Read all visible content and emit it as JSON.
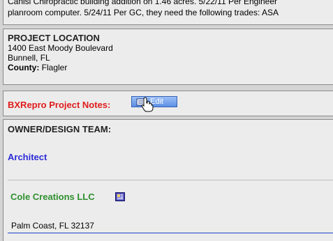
{
  "top": {
    "line1": "Canisi Chiropractic building addition on 1.46 acres. 5/22/11 Per Engineer",
    "line2": "planroom computer. 5/24/11 Per GC, they need the following trades: ASA"
  },
  "location": {
    "title": "PROJECT LOCATION",
    "address": "1400 East Moody Boulevard",
    "city_state": "Bunnell, FL",
    "county_label": "County:",
    "county_value": "Flagler"
  },
  "notes": {
    "label": "BXRepro Project Notes:",
    "edit_label": "Edit"
  },
  "team": {
    "title": "OWNER/DESIGN TEAM:",
    "architect_label": "Architect",
    "company_name": "Cole Creations LLC",
    "company_city": "Palm Coast, FL 32137"
  },
  "colors": {
    "notes_red": "#e01b1b",
    "architect_blue": "#2b2bd8",
    "company_green": "#2f8f2f",
    "edit_button": "#5d8fe4"
  },
  "icons": {
    "edit": "notepad-icon",
    "cursor": "hand-pointer-icon",
    "company": "business-card-icon"
  }
}
